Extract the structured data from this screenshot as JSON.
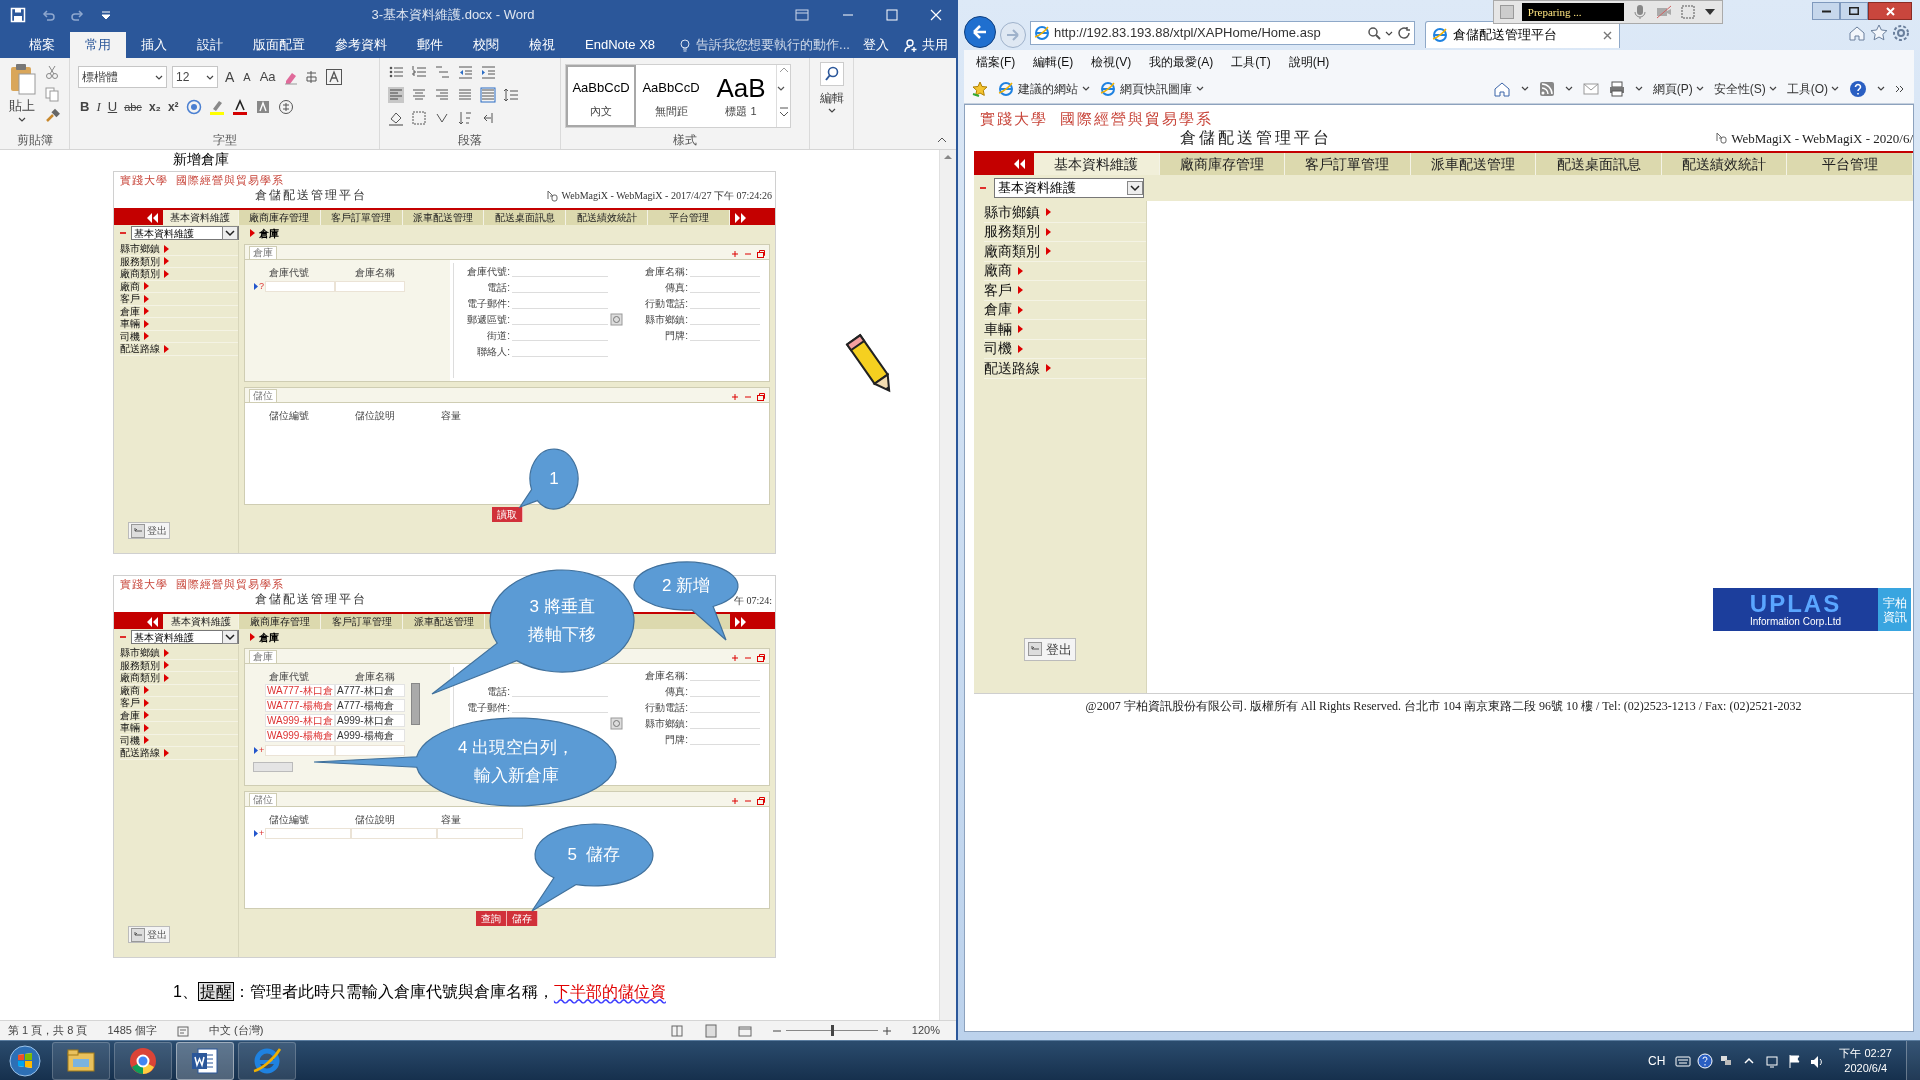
{
  "word": {
    "title": "3-基本資料維護.docx - Word",
    "ribbon_tabs": [
      {
        "label": "檔案",
        "selected": false
      },
      {
        "label": "常用",
        "selected": true
      },
      {
        "label": "插入",
        "selected": false
      },
      {
        "label": "設計",
        "selected": false
      },
      {
        "label": "版面配置",
        "selected": false
      },
      {
        "label": "參考資料",
        "selected": false
      },
      {
        "label": "郵件",
        "selected": false
      },
      {
        "label": "校閱",
        "selected": false
      },
      {
        "label": "檢視",
        "selected": false
      },
      {
        "label": "EndNote X8",
        "selected": false
      }
    ],
    "tell_me": "告訴我您想要執行的動作...",
    "sign_in": "登入",
    "share": "共用",
    "ribbon": {
      "paste": "貼上",
      "font_name": "標楷體",
      "font_size": "12",
      "font_row1": [
        "A",
        "A",
        "Aa"
      ],
      "font_row2": [
        "B",
        "I",
        "U",
        "abc",
        "x₂",
        "x²"
      ],
      "styles": [
        {
          "preview": "AaBbCcD",
          "name": "內文",
          "selected": true
        },
        {
          "preview": "AaBbCcD",
          "name": "無間距",
          "selected": false
        },
        {
          "preview": "AaB",
          "name": "標題 1",
          "selected": false
        }
      ],
      "editing": "編輯",
      "groups": [
        "剪貼簿",
        "字型",
        "段落",
        "樣式"
      ]
    },
    "document": {
      "heading": "新增倉庫",
      "figures": [
        {
          "app": {
            "school": "實踐大學  國際經營與貿易學系",
            "platform": "倉儲配送管理平台",
            "user_info": "WebMagiX - WebMagiX - 2017/4/27 下午 07:24:26",
            "tabs": [
              {
                "label": "基本資料維護",
                "selected": true
              },
              {
                "label": "廠商庫存管理",
                "selected": false
              },
              {
                "label": "客戶訂單管理",
                "selected": false
              },
              {
                "label": "派車配送管理",
                "selected": false
              },
              {
                "label": "配送桌面訊息",
                "selected": false
              },
              {
                "label": "配送績效統計",
                "selected": false
              },
              {
                "label": "平台管理",
                "selected": false
              }
            ],
            "module_select": "基本資料維護",
            "breadcrumb": "倉庫",
            "menu": [
              "縣市鄉鎮",
              "服務類別",
              "廠商類別",
              "廠商",
              "客戶",
              "倉庫",
              "車輛",
              "司機",
              "配送路線"
            ],
            "logout": "登出",
            "master": {
              "tab": "倉庫",
              "columns": [
                "倉庫代號",
                "倉庫名稱"
              ],
              "new_row_marker": "?",
              "form": [
                {
                  "left": "倉庫代號:",
                  "right": "倉庫名稱:"
                },
                {
                  "left": "電話:",
                  "right": "傳真:"
                },
                {
                  "left": "電子郵件:",
                  "right": "行動電話:"
                },
                {
                  "left": "郵遞區號:",
                  "right": "縣市鄉鎮:"
                },
                {
                  "left": "街道:",
                  "right": "門牌:"
                },
                {
                  "left": "聯絡人:"
                }
              ]
            },
            "detail": {
              "tab": "儲位",
              "columns": [
                "儲位編號",
                "儲位說明",
                "容量"
              ]
            },
            "buttons": [
              "讀取"
            ]
          },
          "callouts": [
            {
              "lines": [
                "1"
              ]
            }
          ]
        },
        {
          "app": {
            "school": "實踐大學  國際經營與貿易學系",
            "platform": "倉儲配送管理平台",
            "user_info": "午 07:24:",
            "tabs": [
              {
                "label": "基本資料維護",
                "selected": true
              },
              {
                "label": "廠商庫存管理",
                "selected": false
              },
              {
                "label": "客戶訂單管理",
                "selected": false
              },
              {
                "label": "派車配送管理",
                "selected": false
              }
            ],
            "module_select": "基本資料維護",
            "breadcrumb": "倉庫",
            "menu": [
              "縣市鄉鎮",
              "服務類別",
              "廠商類別",
              "廠商",
              "客戶",
              "倉庫",
              "車輛",
              "司機",
              "配送路線"
            ],
            "logout": "登出",
            "master": {
              "tab": "倉庫",
              "columns": [
                "倉庫代號",
                "倉庫名稱"
              ],
              "rows": [
                [
                  "WA777-林口倉",
                  "A777-林口倉"
                ],
                [
                  "WA777-楊梅倉",
                  "A777-楊梅倉"
                ],
                [
                  "WA999-林口倉",
                  "A999-林口倉"
                ],
                [
                  "WA999-楊梅倉",
                  "A999-楊梅倉"
                ]
              ],
              "new_row_marker": "+",
              "form": [
                {
                  "right": "倉庫名稱:"
                },
                {
                  "left": "電話:",
                  "right": "傳真:"
                },
                {
                  "left": "電子郵件:",
                  "right": "行動電話:"
                },
                {
                  "right": "縣市鄉鎮:"
                },
                {
                  "right": "門牌:"
                }
              ]
            },
            "detail": {
              "tab": "儲位",
              "columns": [
                "儲位編號",
                "儲位說明",
                "容量"
              ],
              "new_row_marker": "+"
            },
            "buttons": [
              "查詢",
              "儲存"
            ]
          },
          "callouts": [
            {
              "lines": [
                "2 新增"
              ]
            },
            {
              "lines": [
                "3 將垂直",
                "捲軸下移"
              ]
            },
            {
              "lines": [
                "4 出現空白列，",
                "輸入新倉庫"
              ]
            },
            {
              "lines": [
                "5  儲存"
              ]
            }
          ]
        }
      ],
      "paragraph": {
        "number": "1、",
        "label": "提醒",
        "text": "：管理者此時只需輸入倉庫代號與倉庫名稱，",
        "highlight": "下半部的儲位資"
      }
    },
    "status_bar": {
      "page": "第 1 頁，共 8 頁",
      "words": "1485 個字",
      "language": "中文 (台灣)",
      "zoom": "120%",
      "zoom_slider": {
        "level": 0.5
      }
    }
  },
  "ie": {
    "recorder_status": "Preparing ...",
    "address": "http://192.83.193.88/xtpl/XAPHome/Home.asp",
    "tab_title": "倉儲配送管理平台",
    "menu": [
      "檔案(F)",
      "編輯(E)",
      "檢視(V)",
      "我的最愛(A)",
      "工具(T)",
      "說明(H)"
    ],
    "favorites": [
      "建議的網站",
      "網頁快訊圖庫"
    ],
    "commands": [
      "網頁(P)",
      "安全性(S)",
      "工具(O)"
    ],
    "app": {
      "school": "實踐大學  國際經營與貿易學系",
      "platform": "倉儲配送管理平台",
      "user_info": "WebMagiX - WebMagiX - 2020/6/",
      "tabs": [
        {
          "label": "基本資料維護",
          "selected": true
        },
        {
          "label": "廠商庫存管理",
          "selected": false
        },
        {
          "label": "客戶訂單管理",
          "selected": false
        },
        {
          "label": "派車配送管理",
          "selected": false
        },
        {
          "label": "配送桌面訊息",
          "selected": false
        },
        {
          "label": "配送績效統計",
          "selected": false
        },
        {
          "label": "平台管理",
          "selected": false
        }
      ],
      "module_select": "基本資料維護",
      "menu": [
        "縣市鄉鎮",
        "服務類別",
        "廠商類別",
        "廠商",
        "客戶",
        "倉庫",
        "車輛",
        "司機",
        "配送路線"
      ],
      "logout": "登出",
      "logo": {
        "name": "UPLAS",
        "subtitle": "Information Corp.Ltd",
        "chinese": [
          "宇柏",
          "資訊"
        ]
      },
      "footer": "@2007 宇柏資訊股份有限公司. 版權所有 All Rights Reserved. 台北市 104 南京東路二段 96號 10 樓 / Tel: (02)2523-1213 / Fax: (02)2521-2032"
    }
  },
  "taskbar": {
    "apps": [
      {
        "kind": "explorer",
        "selected": false
      },
      {
        "kind": "chrome",
        "selected": false
      },
      {
        "kind": "word",
        "selected": true
      },
      {
        "kind": "ie",
        "selected": false
      }
    ],
    "input_language": "CH",
    "time": "下午 02:27",
    "date": "2020/6/4"
  }
}
